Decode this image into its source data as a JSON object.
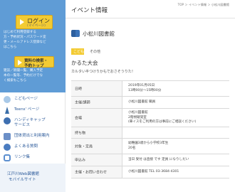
{
  "sidebar": {
    "login": {
      "label": "ログイン",
      "sub": "(マイページ)"
    },
    "login_desc": [
      "はじめて利用登録する",
      "方・予約状況・パスワード変",
      "更・メールアドレス登録など",
      "はこちら"
    ],
    "search": {
      "line1": "資料の検索・",
      "line2": "予約トップ"
    },
    "search_desc": [
      "雑誌／新聞一覧、購入予定",
      "本の一覧等、予約だけでな",
      "く検索もこちら"
    ],
    "links": [
      {
        "label": "こどもページ",
        "icon": "kids-icon"
      },
      {
        "label": "Teens' ページ",
        "icon": "teens-icon"
      },
      {
        "label_lines": [
          "ハンディキャップ",
          "サービス"
        ],
        "icon": "handicap-icon"
      },
      {
        "label": "団体貸出と利用案内",
        "icon": "group-icon"
      },
      {
        "label": "よくある質問",
        "icon": "faq-icon"
      },
      {
        "label": "リンク集",
        "icon": "link-icon"
      }
    ],
    "web": {
      "line1": "江戸川Web図書館",
      "line2": "モバイルサイト"
    }
  },
  "main": {
    "title": "イベント情報",
    "breadcrumb": "TOP ＞ イベント情報 ＞ 小松川図書館",
    "library": "小松川図書館",
    "category": {
      "badge": "こども",
      "other": "その他"
    },
    "event_title": "かるた大会",
    "lead": "カルタい半つけりかもでおさそうりた！",
    "rows": [
      {
        "label": "日時",
        "lines": [
          "2019年01月05日",
          "13時00分～15時00分"
        ]
      },
      {
        "label": "主催/講師",
        "lines": [
          "小松川図書館 職員"
        ]
      },
      {
        "label": "会場",
        "lines": [
          "小松川図書館",
          "2階視聴覚室",
          "(車イスをご利用の方は事前にご相談ください)"
        ]
      },
      {
        "label": "持ち物",
        "lines": [
          ""
        ]
      },
      {
        "label": "対象・定員",
        "lines": [
          "幼稚園3歳から小学校3年生",
          "20名"
        ]
      },
      {
        "label": "申込み",
        "lines": [
          "当日 受付 は直接 です 定員 になりしだい"
        ]
      },
      {
        "label": "主催・お問い合わせ",
        "lines": [
          "小松川図書館  TEL 03-3684-4301"
        ]
      }
    ]
  }
}
